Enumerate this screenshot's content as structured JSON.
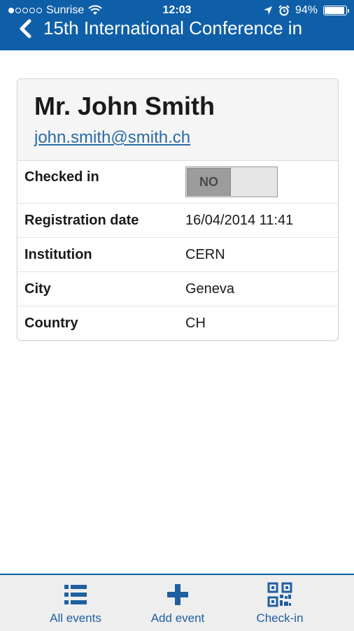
{
  "status_bar": {
    "carrier": "Sunrise",
    "time": "12:03",
    "battery": "94%"
  },
  "nav": {
    "title": "15th International Conference in"
  },
  "profile": {
    "name": "Mr. John Smith",
    "email": "john.smith@smith.ch"
  },
  "details": {
    "checked_in_label": "Checked in",
    "checked_in_value": "NO",
    "rows": [
      {
        "label": "Registration date",
        "value": "16/04/2014 11:41"
      },
      {
        "label": "Institution",
        "value": "CERN"
      },
      {
        "label": "City",
        "value": "Geneva"
      },
      {
        "label": "Country",
        "value": "CH"
      }
    ]
  },
  "tabbar": {
    "items": [
      {
        "label": "All events",
        "icon": "list-icon"
      },
      {
        "label": "Add event",
        "icon": "plus-icon"
      },
      {
        "label": "Check-in",
        "icon": "qr-code-icon"
      }
    ]
  },
  "colors": {
    "header": "#0f5fa8",
    "link": "#2a6aa7",
    "tab_label": "#1f5fa0"
  }
}
